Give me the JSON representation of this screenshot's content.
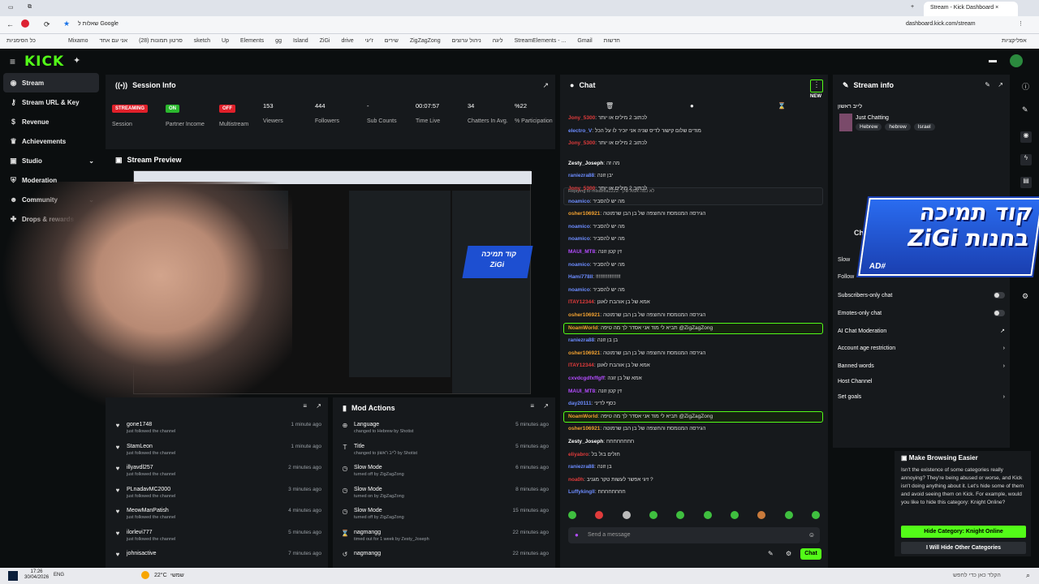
{
  "browser": {
    "tabs": [
      {
        "label": "Stream - Kick Dashboard"
      },
      {
        "label": "שאלות ל Google"
      }
    ],
    "url": "dashboard.kick.com/stream",
    "bookmarks_right": "אפליקציות",
    "bookmarks_left": "כל הסימניות",
    "bookmark_items": [
      "Mixamo",
      "אני עם אחד",
      "(28) סרטון תמונות",
      "sketch",
      "Up",
      "Elements",
      "gg",
      "Island",
      "ZiGi",
      "drive",
      "ז'יגי",
      "שירים",
      "ZigZagZong",
      "ניהול ערוצים",
      "ליגה",
      "StreamElements - ...",
      "Gmail",
      "חדשות"
    ]
  },
  "kick": {
    "logo": "KICK"
  },
  "sidebar": {
    "items": [
      {
        "label": "Stream",
        "icon": "broadcast-icon",
        "active": true
      },
      {
        "label": "Stream URL & Key",
        "icon": "key-icon"
      },
      {
        "label": "Revenue",
        "icon": "dollar-icon"
      },
      {
        "label": "Achievements",
        "icon": "trophy-icon"
      },
      {
        "label": "Studio",
        "icon": "studio-icon",
        "chevron": true
      },
      {
        "label": "Moderation",
        "icon": "shield-icon"
      },
      {
        "label": "Community",
        "icon": "people-icon",
        "chevron": true
      },
      {
        "label": "Drops & rewards",
        "icon": "gift-icon"
      }
    ]
  },
  "session": {
    "title": "Session Info",
    "stats": [
      {
        "value": "STREAMING",
        "label": "Session",
        "badge": "#e0202a"
      },
      {
        "value": "ON",
        "label": "Partner Income",
        "badge": "#2bb82e"
      },
      {
        "value": "OFF",
        "label": "Multistream",
        "badge": "#e0202a"
      },
      {
        "value": "153",
        "label": "Viewers"
      },
      {
        "value": "444",
        "label": "Followers"
      },
      {
        "value": "-",
        "label": "Sub Counts"
      },
      {
        "value": "00:07:57",
        "label": "Time Live"
      },
      {
        "value": "34",
        "label": "Chatters In Avg."
      },
      {
        "value": "%22",
        "label": "% Participation"
      }
    ]
  },
  "preview": {
    "title": "Stream Preview"
  },
  "overlay": {
    "line1": "קוד תמיכה",
    "line2": "ZiGi בחנות",
    "tag": "AD#"
  },
  "activity": [
    {
      "user": "gone1748",
      "sub": "just followed the channel",
      "time": "1 minute ago"
    },
    {
      "user": "StamLeon",
      "sub": "just followed the channel",
      "time": "1 minute ago"
    },
    {
      "user": "illyavdl257",
      "sub": "just followed the channel",
      "time": "2 minutes ago"
    },
    {
      "user": "PLnadavMC2000",
      "sub": "just followed the channel",
      "time": "3 minutes ago"
    },
    {
      "user": "MeowManPatish",
      "sub": "just followed the channel",
      "time": "4 minutes ago"
    },
    {
      "user": "ilorlevi777",
      "sub": "just followed the channel",
      "time": "5 minutes ago"
    },
    {
      "user": "johnisactive",
      "sub": "",
      "time": "7 minutes ago"
    }
  ],
  "mod": {
    "title": "Mod Actions",
    "rows": [
      {
        "icon": "globe-icon",
        "title": "Language",
        "sub": "changed to Hebrew by Shotist",
        "time": "5 minutes ago"
      },
      {
        "icon": "title-icon",
        "title": "Title",
        "sub": "changed to לייב ראשון by Shotist",
        "time": "5 minutes ago"
      },
      {
        "icon": "clock-icon",
        "title": "Slow Mode",
        "sub": "turned off by ZigZagZong",
        "time": "6 minutes ago"
      },
      {
        "icon": "clock-icon",
        "title": "Slow Mode",
        "sub": "turned on by ZigZagZong",
        "time": "8 minutes ago"
      },
      {
        "icon": "clock-icon",
        "title": "Slow Mode",
        "sub": "turned off by ZigZagZong",
        "time": "15 minutes ago"
      },
      {
        "icon": "hourglass-icon",
        "title": "nagmangg",
        "sub": "timed out for 1 week by Zesty_Joseph",
        "time": "22 minutes ago"
      },
      {
        "icon": "undo-icon",
        "title": "nagmangg",
        "sub": "",
        "time": "22 minutes ago"
      }
    ]
  },
  "chat": {
    "title": "Chat",
    "new_label": "NEW",
    "placeholder": "Send a message",
    "send": "Chat",
    "messages": [
      {
        "user": "Jony_5300",
        "color": "#e03b3b",
        "text": "לכתוב 2 מילים או יותר"
      },
      {
        "user": "electro_V",
        "color": "#6c8cff",
        "text": "מודים שלום קישור לדיס שניה אני יוכיר לו על הכל"
      },
      {
        "user": "Jony_5300",
        "color": "#e03b3b",
        "text": "לכתוב 2 מילים או יותר"
      },
      {
        "user": "Zesty_Joseph",
        "color": "#fff",
        "text": "מה זה",
        "reply": "Replying to misamia1222: לא כמה אמא שלך"
      },
      {
        "user": "raniezra88",
        "color": "#6c8cff",
        "text": "יבן זונה"
      },
      {
        "user": "Jony_5300",
        "color": "#e03b3b",
        "text": "לכתוב 2 מילים או יותר"
      },
      {
        "user": "noamico",
        "color": "#6c8cff",
        "text": "מה יש להסביר"
      },
      {
        "user": "osher106921",
        "color": "#f0a030",
        "text": "הגירסה המנומסת והחוצפה של בן הבן שרמוטה"
      },
      {
        "user": "noamico",
        "color": "#6c8cff",
        "text": "מה יש להסביר"
      },
      {
        "user": "noamico",
        "color": "#6c8cff",
        "text": "מה יש להסביר"
      },
      {
        "user": "MAUI_MT8",
        "color": "#b44cff",
        "text": "זין קטן זונה"
      },
      {
        "user": "noamico",
        "color": "#6c8cff",
        "text": "מה יש להסביר"
      },
      {
        "user": "Hami778II",
        "color": "#6c8cff",
        "text": "!!!!!!!!!!!!!!!!!"
      },
      {
        "user": "noamico",
        "color": "#6c8cff",
        "text": "מה יש להסביר"
      },
      {
        "user": "ITAY12344",
        "color": "#e03b3b",
        "text": "אמא של בן אוהבת לאונן"
      },
      {
        "user": "osher106921",
        "color": "#f0a030",
        "text": "הגירסה המנומסת והחוצפה של בן הבן שרמוטה"
      },
      {
        "user": "NoamWorld",
        "color": "#f0a030",
        "text": "תביא לי מוד אני אסדר לך מה טיפה @ZigZagZong",
        "hl": true
      },
      {
        "user": "raniezra88",
        "color": "#6c8cff",
        "text": "בן בן זונה"
      },
      {
        "user": "osher106921",
        "color": "#f0a030",
        "text": "הגירסה המנומסת והחוצפה של בן הבן שרמוטה"
      },
      {
        "user": "ITAY12344",
        "color": "#e03b3b",
        "text": "אמא של בן אוהבת לאונן"
      },
      {
        "user": "cxvdcgdfxffgff",
        "color": "#b44cff",
        "text": "אמא של בן זונה"
      },
      {
        "user": "MAUI_MT8",
        "color": "#b44cff",
        "text": "זין קטן זונה"
      },
      {
        "user": "day20111",
        "color": "#6c8cff",
        "text": "כסף לדיני"
      },
      {
        "user": "NoamWorld",
        "color": "#f0a030",
        "text": "תביא לי מוד אני אסדר לך מה טיפה @ZigZagZong",
        "hl": true
      },
      {
        "user": "osher106921",
        "color": "#f0a030",
        "text": "הגירסה המנומסת והחוצפה של בן הבן שרמוטה"
      },
      {
        "user": "Zesty_Joseph",
        "color": "#fff",
        "text": "חחחחחחחח"
      },
      {
        "user": "eliyabro",
        "color": "#e03b3b",
        "text": "חולים בול בל"
      },
      {
        "user": "raniezra88",
        "color": "#6c8cff",
        "text": "בן זונה"
      },
      {
        "user": "noa0h",
        "color": "#e03b3b",
        "text": "זיגי אפשר לעשות טקר מגניב ?"
      },
      {
        "user": "Luffykingll",
        "color": "#6c8cff",
        "text": "חחחחחחחח"
      }
    ]
  },
  "streaminfo": {
    "title": "Stream info",
    "stream_title": "לייב ראשון",
    "category": "Just Chatting",
    "tags": [
      "Hebrew",
      "hebrew",
      "Israel"
    ],
    "chat_header": "Ch",
    "slow": "Slow",
    "follow": "Follow",
    "settings": [
      {
        "label": "Subscribers-only chat",
        "control": "toggle"
      },
      {
        "label": "Emotes-only chat",
        "control": "toggle"
      },
      {
        "label": "AI Chat Moderation",
        "control": "external"
      },
      {
        "label": "Account age restriction",
        "control": "chevron"
      },
      {
        "label": "Banned words",
        "control": "chevron"
      },
      {
        "label": "Host Channel",
        "control": "none"
      },
      {
        "label": "Set goals",
        "control": "chevron"
      }
    ]
  },
  "popup": {
    "title": "Make Browsing Easier",
    "body": "Isn't the existence of some categories really annoying? They're being abused or worse, and Kick isn't doing anything about it. Let's hide some of them and avoid seeing them on Kick. For example, would you like to hide this category: Knight Online?",
    "btn_primary": "Hide Category: Knight Online",
    "btn_secondary": "I Will Hide Other Categories"
  },
  "taskbar": {
    "time": "17:26",
    "date": "30/04/2026",
    "lang": "ENG",
    "weather": "22°C",
    "weather_label": "שמשי",
    "search": "הקלד כאן כדי לחפש"
  }
}
